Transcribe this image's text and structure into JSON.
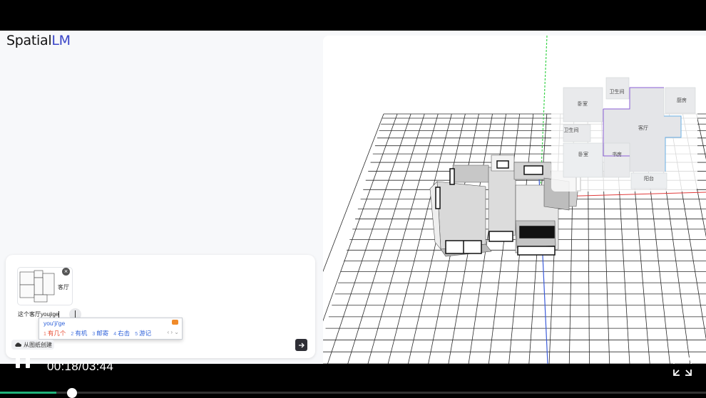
{
  "app": {
    "logo_main": "Spatial",
    "logo_accent": "LM"
  },
  "floorplan_rooms": [
    "卧室",
    "卫生间",
    "厨房",
    "客厅",
    "卫生间",
    "卧室",
    "书房",
    "阳台"
  ],
  "prompt_panel": {
    "thumbnail_label": "客厅",
    "input_value": "这个客厅youjige",
    "create_button_label": "从图纸创建",
    "send_icon": "arrow-right-icon"
  },
  "ime": {
    "pinyin": "you'ji'ge",
    "candidates": [
      {
        "num": "1",
        "text": "有几个"
      },
      {
        "num": "2",
        "text": "有机"
      },
      {
        "num": "3",
        "text": "邮寄"
      },
      {
        "num": "4",
        "text": "右击"
      },
      {
        "num": "5",
        "text": "游记"
      }
    ],
    "nav": "‹ › ⌄"
  },
  "video": {
    "current_time": "00:18",
    "duration": "03:44",
    "time_display": "00:18/03:44",
    "progress": 0.08
  },
  "colors": {
    "accent": "#3a45c8",
    "progress": "#1fb27a",
    "ime_highlight": "#e8482e"
  }
}
